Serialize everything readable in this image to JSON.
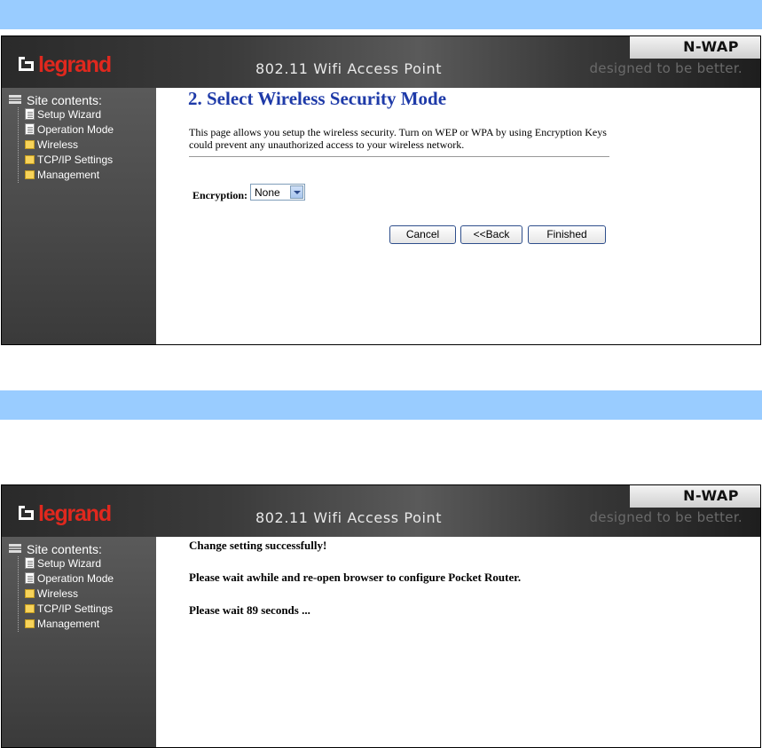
{
  "header": {
    "brand": "legrand",
    "title": "802.11 Wifi Access Point",
    "product": "N-WAP",
    "tagline": "designed to be better."
  },
  "sidebar": {
    "title": "Site contents:",
    "items": [
      {
        "label": "Setup Wizard",
        "icon": "page-icon"
      },
      {
        "label": "Operation Mode",
        "icon": "page-icon"
      },
      {
        "label": "Wireless",
        "icon": "folder-icon"
      },
      {
        "label": "TCP/IP Settings",
        "icon": "folder-icon"
      },
      {
        "label": "Management",
        "icon": "folder-icon"
      }
    ]
  },
  "panel1": {
    "heading": "2. Select Wireless Security Mode",
    "description": "This page allows you setup the wireless security. Turn on WEP or WPA by using Encryption Keys could prevent any unauthorized access to your wireless network.",
    "encryption_label": "Encryption:",
    "encryption_value": "None",
    "buttons": {
      "cancel": "Cancel",
      "back": "<<Back",
      "finished": "Finished"
    }
  },
  "panel2": {
    "messages": [
      "Change setting successfully!",
      "Please wait awhile and re-open browser to configure Pocket Router.",
      "Please wait 89 seconds ..."
    ]
  },
  "colors": {
    "bar": "#99ccff",
    "heading": "#1e3aa8",
    "brand_red": "#e0281e"
  }
}
